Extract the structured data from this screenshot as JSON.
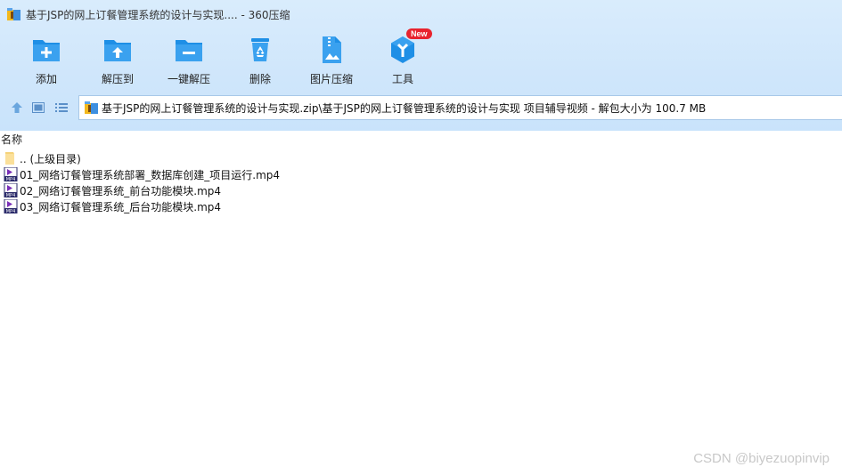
{
  "window": {
    "title": "基于JSP的网上订餐管理系统的设计与实现.... - 360压缩"
  },
  "toolbar": {
    "items": [
      {
        "label": "添加",
        "icon": "folder-add-icon"
      },
      {
        "label": "解压到",
        "icon": "folder-extract-icon"
      },
      {
        "label": "一键解压",
        "icon": "folder-quick-extract-icon"
      },
      {
        "label": "删除",
        "icon": "recycle-bin-icon"
      },
      {
        "label": "图片压缩",
        "icon": "image-compress-icon"
      },
      {
        "label": "工具",
        "icon": "tools-icon",
        "badge": "New"
      }
    ]
  },
  "address": {
    "path": "基于JSP的网上订餐管理系统的设计与实现.zip\\基于JSP的网上订餐管理系统的设计与实现 项目辅导视频 - 解包大小为 100.7 MB"
  },
  "columns": {
    "name": "名称"
  },
  "files": [
    {
      "name": ".. (上级目录)",
      "type": "parent-folder"
    },
    {
      "name": "01_网络订餐管理系统部署_数据库创建_项目运行.mp4",
      "type": "mp4"
    },
    {
      "name": "02_网络订餐管理系统_前台功能模块.mp4",
      "type": "mp4"
    },
    {
      "name": "03_网络订餐管理系统_后台功能模块.mp4",
      "type": "mp4"
    }
  ],
  "watermark": "CSDN @biyezuopinvip",
  "colors": {
    "accent": "#1e8fe6",
    "header_bg": "#d3e8fb",
    "badge": "#e8232e"
  }
}
